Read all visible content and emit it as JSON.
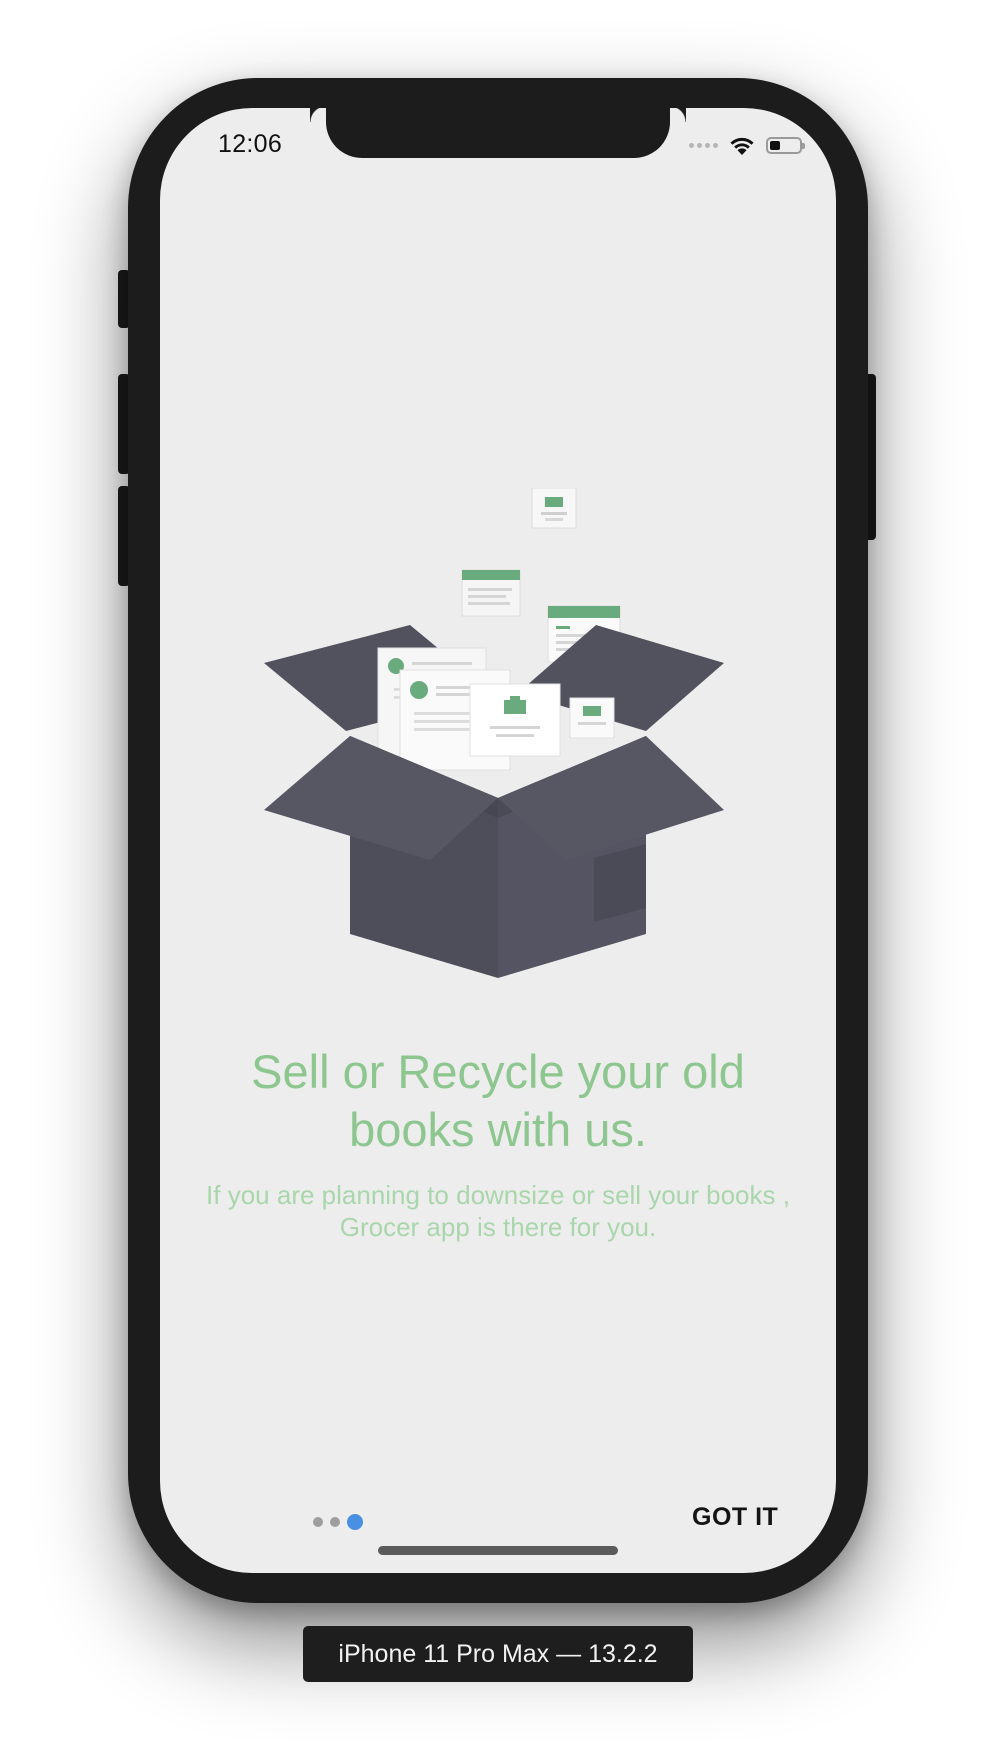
{
  "status_bar": {
    "time": "12:06",
    "icons": [
      "cellular-dots-icon",
      "wifi-icon",
      "battery-icon"
    ]
  },
  "onboarding": {
    "illustration": "open-box-with-books-illustration",
    "headline": "Sell or Recycle your old books with us.",
    "description": "If you are planning to downsize or sell your books , Grocer app is there for you.",
    "page_indicator": {
      "total": 3,
      "current": 3
    },
    "got_it_label": "GOT IT"
  },
  "device": {
    "label": "iPhone 11 Pro Max — 13.2.2"
  },
  "colors": {
    "screen_background": "#ededed",
    "headline": "#8dc68f",
    "description": "#a9d6ab",
    "active_dot": "#4a90e2",
    "inactive_dot": "#9e9e9e",
    "box": "#52525f",
    "card_accent": "#6aab7e"
  }
}
